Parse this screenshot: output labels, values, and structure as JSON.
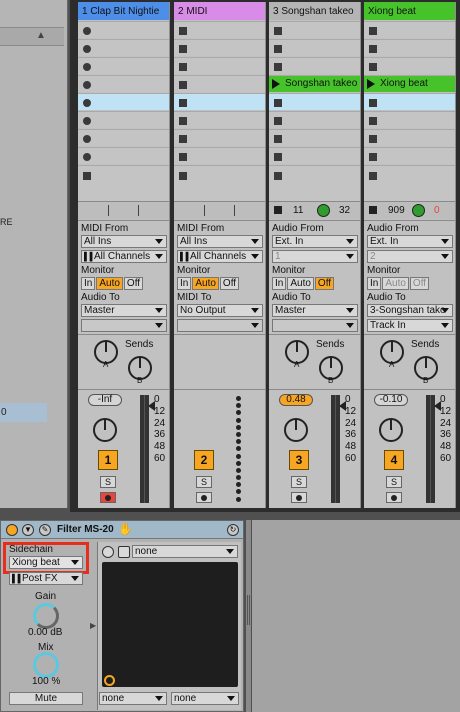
{
  "browser": {
    "partial_text": "RE",
    "selected_row": "0"
  },
  "tracks": [
    {
      "title": "1 Clap Bit Nightie",
      "color": "#4d8ee8",
      "slot_shape": "round",
      "slots": [
        "",
        "",
        "",
        "",
        "",
        "",
        "",
        ""
      ],
      "clip_index": -1,
      "highlight_index": 4,
      "io": {
        "in_label": "MIDI From",
        "in_value": "All Ins",
        "in_sub": "All Channels",
        "in_sub_dim": false,
        "monitor_label": "Monitor",
        "monitor": [
          "In",
          "Auto",
          "Off"
        ],
        "monitor_active": "Auto",
        "out_label": "Audio To",
        "out_value": "Master",
        "out_sub": ""
      },
      "volume": "-Inf",
      "volume_active": false,
      "number": "1",
      "solo": "S",
      "arm": "red",
      "meter": true
    },
    {
      "title": "2 MIDI",
      "color": "#d98be8",
      "slot_shape": "square",
      "slots": [
        "",
        "",
        "",
        "",
        "",
        "",
        "",
        ""
      ],
      "clip_index": -1,
      "highlight_index": 4,
      "io": {
        "in_label": "MIDI From",
        "in_value": "All Ins",
        "in_sub": "All Channels",
        "in_sub_dim": false,
        "monitor_label": "Monitor",
        "monitor": [
          "In",
          "Auto",
          "Off"
        ],
        "monitor_active": "Auto",
        "out_label": "MIDI To",
        "out_value": "No Output",
        "out_sub": ""
      },
      "volume": "",
      "volume_active": false,
      "number": "2",
      "solo": "S",
      "arm": "midi",
      "meter": false
    },
    {
      "title": "3 Songshan takeo",
      "color": "#b4b4b4",
      "slot_shape": "square",
      "slots": [
        "",
        "",
        "",
        "Songshan takeo",
        "",
        "",
        "",
        ""
      ],
      "clip_index": 3,
      "highlight_index": 4,
      "io": {
        "in_label": "Audio From",
        "in_value": "Ext. In",
        "in_sub": "1",
        "in_sub_dim": true,
        "monitor_label": "Monitor",
        "monitor": [
          "In",
          "Auto",
          "Off"
        ],
        "monitor_active": "Off",
        "out_label": "Audio To",
        "out_value": "Master",
        "out_sub": ""
      },
      "stop_left": "11",
      "stop_right": "32",
      "volume": "0.48",
      "volume_active": true,
      "number": "3",
      "solo": "S",
      "arm": "dot",
      "meter": true
    },
    {
      "title": "Xiong beat",
      "color": "#46c32a",
      "slot_shape": "square",
      "slots": [
        "",
        "",
        "",
        "Xiong beat",
        "",
        "",
        "",
        ""
      ],
      "clip_index": 3,
      "highlight_index": 4,
      "io": {
        "in_label": "Audio From",
        "in_value": "Ext. In",
        "in_sub": "2",
        "in_sub_dim": true,
        "monitor_label": "Monitor",
        "monitor": [
          "In",
          "Auto",
          "Off"
        ],
        "monitor_active": "none",
        "out_label": "Audio To",
        "out_value": "3-Songshan tako",
        "out_sub": "Track In"
      },
      "stop_left": "909",
      "stop_right": "0",
      "volume": "-0.10",
      "volume_active": false,
      "number": "4",
      "solo": "S",
      "arm": "dot",
      "meter": true
    }
  ],
  "sends_label": "Sends",
  "send_a": "A",
  "send_b": "B",
  "meter_ticks": [
    "0",
    "12",
    "24",
    "36",
    "48",
    "60"
  ],
  "device": {
    "title": "Filter MS-20",
    "sidechain_label": "Sidechain",
    "sidechain_value": "Xiong beat",
    "position_value": "Post FX",
    "gain_label": "Gain",
    "gain_value": "0.00 dB",
    "mix_label": "Mix",
    "mix_value": "100 %",
    "mute_label": "Mute",
    "top_field": "none",
    "bottom_left": "none",
    "bottom_right": "none"
  }
}
